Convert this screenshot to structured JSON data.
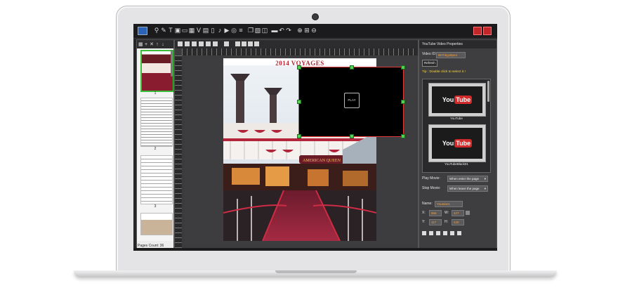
{
  "app": {
    "left_panel": {
      "tool_icons": [
        "grid-icon",
        "plus-icon",
        "close-icon",
        "arrow-up-icon",
        "arrow-down-icon"
      ],
      "thumbnails": [
        {
          "number": "1",
          "selected": true
        },
        {
          "number": "2",
          "selected": false
        },
        {
          "number": "3",
          "selected": false
        },
        {
          "number": "",
          "selected": false
        }
      ],
      "page_count_label": "Pages Count: 36"
    },
    "canvas": {
      "page_title": "2014 VOYAGES",
      "boat_sign": "AMERICAN QUEEN",
      "video_placeholder_label": "PLAY"
    },
    "properties": {
      "header": "YouTube Video Properties",
      "video_id_label": "Video ID:",
      "video_id_value": "tBYhbgv8pe4",
      "refresh_label": "Refresh",
      "tip": "Tip : Double click to select it !",
      "gallery": [
        {
          "caption": "YouTube",
          "logo_you": "You",
          "logo_tube": "Tube"
        },
        {
          "caption": "YouTubeBlack01",
          "logo_you": "You",
          "logo_tube": "Tube"
        }
      ],
      "play_movie_label": "Play Movie:",
      "play_movie_value": "When enter the page",
      "stop_movie_label": "Stop Movie:",
      "stop_movie_value": "When leave the page",
      "name_label": "Name:",
      "name_value": "Youtube1",
      "x_label": "X:",
      "x_value": "955",
      "w_label": "W:",
      "w_value": "427",
      "y_label": "Y:",
      "y_value": "117",
      "h_label": "H:",
      "h_value": "240"
    }
  },
  "colors": {
    "selection_green": "#3bbf3b",
    "video_border": "#e63a3a",
    "title_red": "#b82534",
    "field_value_orange": "#ff9c2b",
    "tip_yellow": "#ffd83a"
  }
}
